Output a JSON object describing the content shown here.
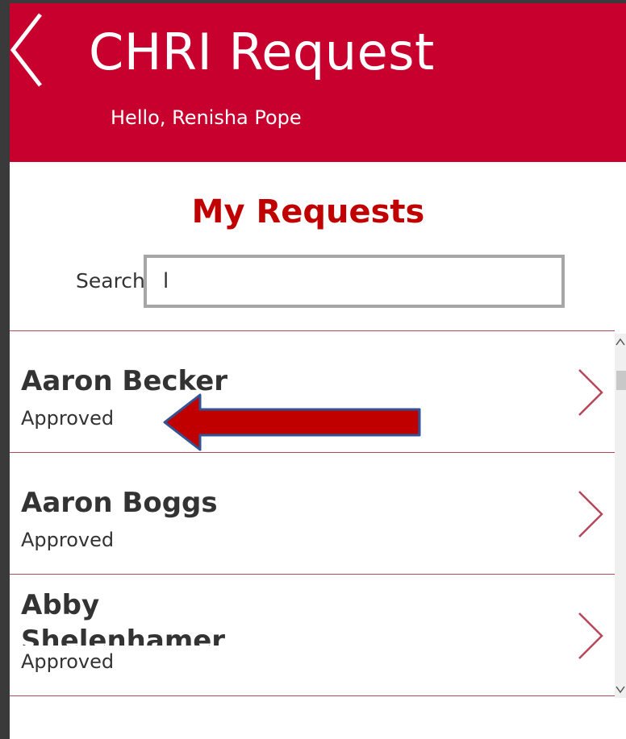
{
  "header": {
    "title": "CHRI Request",
    "greeting": "Hello, Renisha Pope",
    "back_icon": "chevron-left-icon",
    "background": "#c8002d"
  },
  "main": {
    "section_title": "My Requests",
    "search": {
      "label": "Search",
      "value": "l",
      "placeholder": ""
    }
  },
  "requests": [
    {
      "name": "Aaron Becker",
      "status": "Approved"
    },
    {
      "name": "Aaron Boggs",
      "status": "Approved"
    },
    {
      "name": "Abby Shelenhamer",
      "status": "Approved"
    }
  ],
  "annotation": {
    "icon": "arrow-left-icon",
    "color": "#c00000"
  },
  "accent": "#c00000"
}
